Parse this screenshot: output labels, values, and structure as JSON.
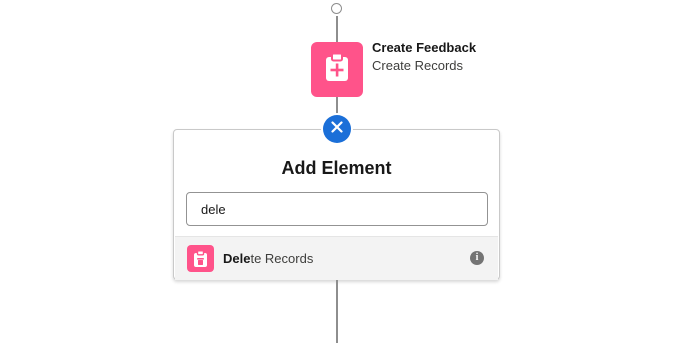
{
  "flow": {
    "node": {
      "title": "Create Feedback",
      "subtitle": "Create Records",
      "icon": "create-records-icon",
      "color": "#ff538a"
    }
  },
  "add_element_panel": {
    "title": "Add Element",
    "close_icon": "close-icon",
    "accent_color": "#1b6fd8",
    "search": {
      "value": "dele",
      "placeholder": ""
    },
    "results": [
      {
        "match": "Dele",
        "rest": "te Records",
        "icon": "delete-records-icon",
        "info_icon": "info-icon",
        "info_glyph": "i"
      }
    ]
  }
}
